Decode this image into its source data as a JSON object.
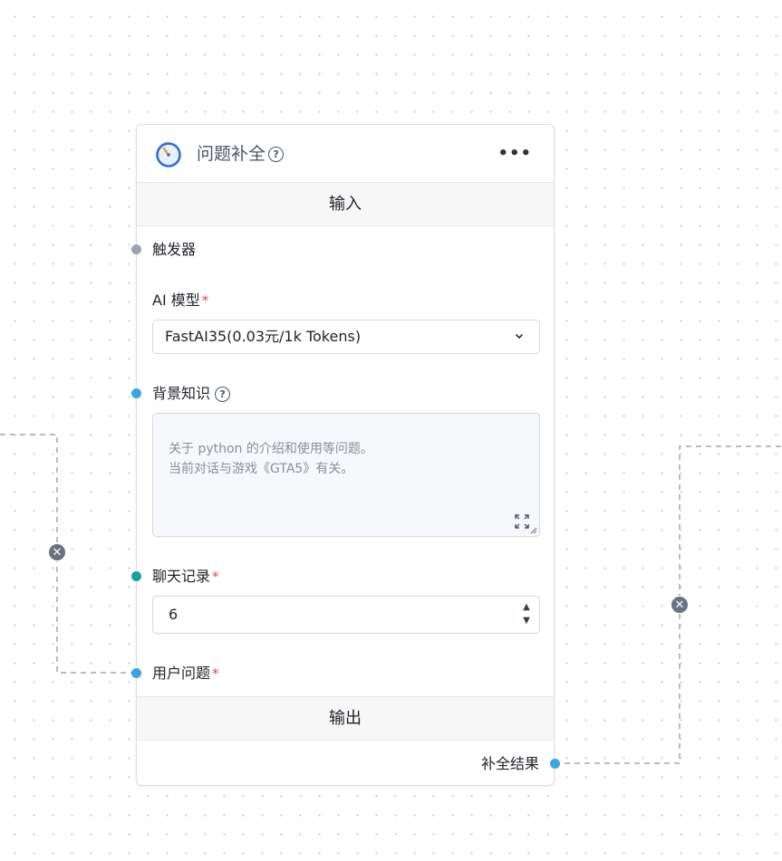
{
  "node": {
    "title": "问题补全",
    "icon": "timer-icon",
    "input_section": "输入",
    "output_section": "输出",
    "fields": {
      "trigger": {
        "label": "触发器"
      },
      "model": {
        "label": "AI 模型",
        "required": "*",
        "value": "FastAI35(0.03元/1k Tokens)"
      },
      "knowledge": {
        "label": "背景知识",
        "placeholder": "关于 python 的介绍和使用等问题。\n当前对话与游戏《GTA5》有关。"
      },
      "history": {
        "label": "聊天记录",
        "required": "*",
        "value": "6"
      },
      "question": {
        "label": "用户问题",
        "required": "*"
      }
    },
    "outputs": {
      "result": {
        "label": "补全结果"
      }
    }
  },
  "colors": {
    "handle_gray": "#9ca3af",
    "handle_blue": "#3aa4e6",
    "handle_teal": "#0fa3a0",
    "required": "#e5484d",
    "edge": "#b8bcc3"
  },
  "icons": [
    "timer-icon",
    "help-icon",
    "more-icon",
    "chevron-down-icon",
    "expand-icon",
    "stepper-up-icon",
    "stepper-down-icon",
    "close-circle-icon"
  ]
}
